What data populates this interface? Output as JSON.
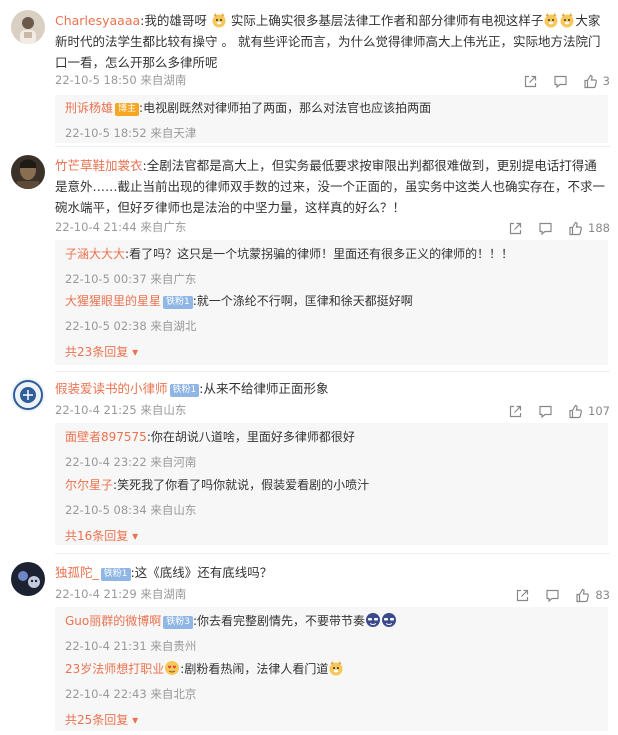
{
  "comments": [
    {
      "username": "Charlesyaaaa",
      "text_a": "我的雄哥呀",
      "text_b": " 实际上确实很多基层法律工作者和部分律师有电视这样子",
      "text_c": "大家新时代的法学生都比较有操守 。 就有些评论而言，为什么觉得律师高大上伟光正，实际地方法院门口一看，怎么开那么多律所呢",
      "time": "22-10-5 18:50",
      "location": "来自湖南",
      "likes": "3",
      "replies": [
        {
          "username": "刑诉杨雄",
          "badge": "博主",
          "text": "电视剧既然对律师拍了两面，那么对法官也应该拍两面",
          "time": "22-10-5 18:52",
          "location": "来自天津"
        }
      ]
    },
    {
      "username": "竹芒草鞋加裳衣",
      "text": "全剧法官都是高大上，但实务最低要求按审限出判都很难做到，更别提电话打得通是意外……截止当前出现的律师双手数的过来，没一个正面的，虽实务中这类人也确实存在，不求一碗水端平，但好歹律师也是法治的中坚力量，这样真的好么？！",
      "time": "22-10-4 21:44",
      "location": "来自广东",
      "likes": "188",
      "replies": [
        {
          "username": "子涵大大大",
          "text": "看了吗？这只是一个坑蒙拐骗的律师！里面还有很多正义的律师的！！！",
          "time": "22-10-5 00:37",
          "location": "来自广东"
        },
        {
          "username": "大猩猩眼里的星星",
          "badge": "铁粉1",
          "text": "就一个涤纶不行啊，匡律和徐天都挺好啊",
          "time": "22-10-5 02:38",
          "location": "来自湖北"
        }
      ],
      "more": "共23条回复"
    },
    {
      "username": "假装爱读书的小律师",
      "badge": "铁粉1",
      "text": "从来不给律师正面形象",
      "time": "22-10-4 21:25",
      "location": "来自山东",
      "likes": "107",
      "replies": [
        {
          "username": "面壁者897575",
          "text": "你在胡说八道啥，里面好多律师都很好",
          "time": "22-10-4 23:22",
          "location": "来自河南"
        },
        {
          "username": "尔尔星子",
          "text": "笑死我了你看了吗你就说，假装爱看剧的小喷汁",
          "time": "22-10-5 08:34",
          "location": "来自山东"
        }
      ],
      "more": "共16条回复"
    },
    {
      "username": "独孤陀_",
      "badge": "铁粉1",
      "text": "这《底线》还有底线吗？",
      "time": "22-10-4 21:29",
      "location": "来自湖南",
      "likes": "83",
      "replies": [
        {
          "username": "Guo丽群的微博啊",
          "badge": "铁粉3",
          "text": "你去看完整剧情先，不要带节奏",
          "time": "22-10-4 21:31",
          "location": "来自贵州"
        },
        {
          "username": "23岁法师想打职业",
          "text_a": "剧粉看热闹，法律人看门道",
          "time": "22-10-4 22:43",
          "location": "来自北京"
        }
      ],
      "more": "共25条回复"
    }
  ],
  "colors": {
    "username": "#eb7350",
    "meta": "#999999",
    "reply_bg": "#f7f7f7",
    "badge_orange": "#f5a623",
    "badge_blue": "#8fb6e5"
  },
  "icons": [
    "share-icon",
    "comment-icon",
    "like-icon",
    "doge-emoji",
    "cool-emoji",
    "chevron-down-icon"
  ]
}
